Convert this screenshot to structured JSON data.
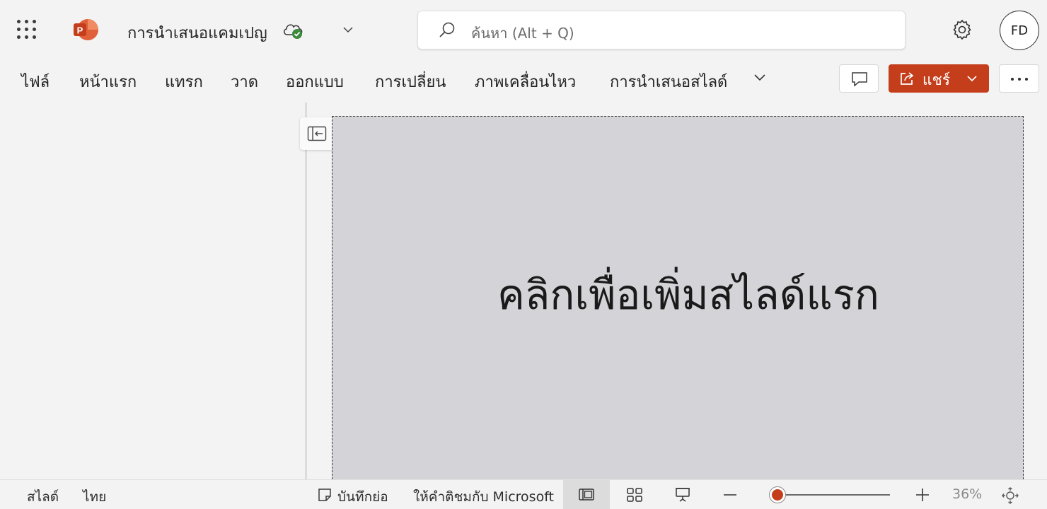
{
  "app": {
    "doc_title": "การนำเสนอแคมเปญ",
    "logo_letter": "P"
  },
  "search": {
    "placeholder": "ค้นหา (Alt + Q)"
  },
  "user": {
    "initials": "FD"
  },
  "ribbon": {
    "tabs": [
      {
        "label": "ไฟล์"
      },
      {
        "label": "หน้าแรก"
      },
      {
        "label": "แทรก"
      },
      {
        "label": "วาด"
      },
      {
        "label": "ออกแบบ"
      },
      {
        "label": "การเปลี่ยน"
      },
      {
        "label": "ภาพเคลื่อนไหว"
      },
      {
        "label": "การนำเสนอสไลด์"
      }
    ],
    "share_label": "แชร์"
  },
  "slide": {
    "prompt": "คลิกเพื่อเพิ่มสไลด์แรก"
  },
  "status": {
    "slide_label": "สไลด์",
    "language": "ไทย",
    "notes_label": "บันทึกย่อ",
    "feedback_label": "ให้คำติชมกับ Microsoft",
    "zoom_value": "36%",
    "zoom_fraction": 0.04
  },
  "colors": {
    "accent": "#c43e1c",
    "slide_bg": "#d3d3d8",
    "sync_ok": "#3c8a3e"
  },
  "icons": [
    "app-launcher-icon",
    "powerpoint-logo-icon",
    "cloud-saved-icon",
    "chevron-down-icon",
    "search-icon",
    "gear-icon",
    "comment-icon",
    "share-icon",
    "more-icon",
    "collapse-pane-icon",
    "notes-icon",
    "normal-view-icon",
    "slide-sorter-icon",
    "reading-view-icon",
    "zoom-out-icon",
    "zoom-in-icon",
    "fit-to-window-icon"
  ]
}
